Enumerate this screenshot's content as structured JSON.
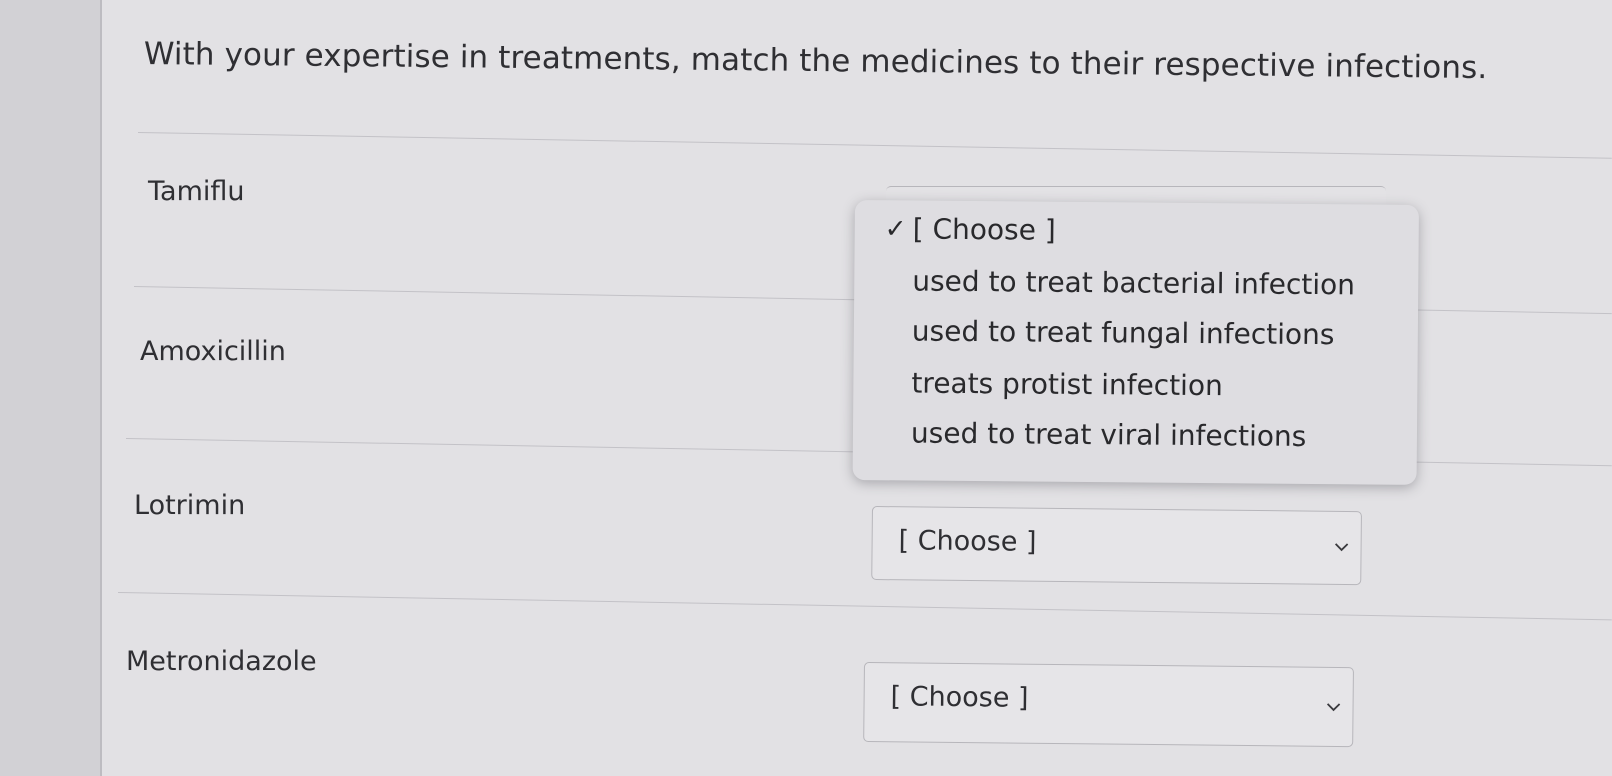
{
  "question": "With your expertise in treatments, match the medicines to their respective infections.",
  "rows": [
    {
      "term": "Tamiflu",
      "selected": "[ Choose ]"
    },
    {
      "term": "Amoxicillin",
      "selected": "[ Choose ]"
    },
    {
      "term": "Lotrimin",
      "selected": "[ Choose ]"
    },
    {
      "term": "Metronidazole",
      "selected": "[ Choose ]"
    }
  ],
  "dropdown": {
    "check_glyph": "✓",
    "options": [
      "[ Choose ]",
      "used to treat bacterial infection",
      "used to treat fungal infections",
      "treats protist infection",
      "used to treat viral infections"
    ],
    "selected_index": 0
  },
  "icons": {
    "chevron": "chevron-down-icon",
    "check": "checkmark-icon"
  }
}
